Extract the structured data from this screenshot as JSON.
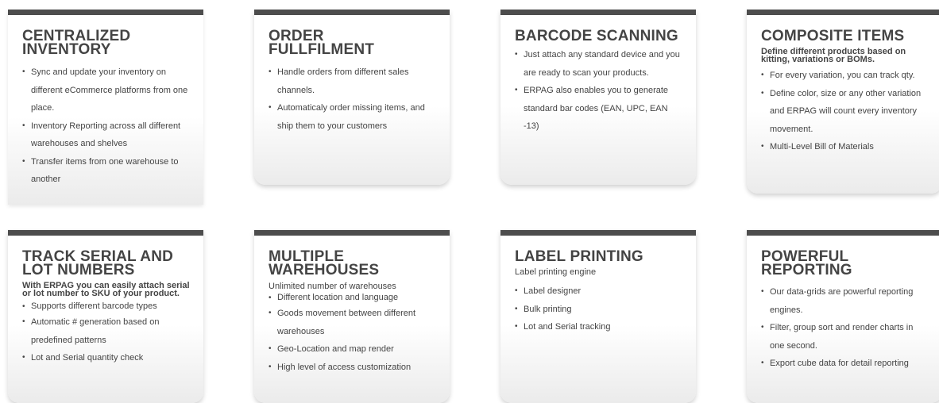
{
  "cards": [
    {
      "title": "CENTRALIZED INVENTORY",
      "subtitle": "",
      "items": [
        "Sync and update your inventory on different eCommerce platforms from one place.",
        "Inventory Reporting across all different warehouses and shelves",
        "Transfer items from one warehouse to another"
      ]
    },
    {
      "title": "ORDER FULLFILMENT",
      "subtitle": "",
      "items": [
        "Handle orders from different sales channels.",
        "Automaticaly order missing items, and ship them to your customers"
      ]
    },
    {
      "title": "BARCODE SCANNING",
      "subtitle": "",
      "items": [
        "Just attach any standard device and you are ready to scan your products.",
        "ERPAG also enables you to generate standard bar codes (EAN, UPC, EAN -13)"
      ]
    },
    {
      "title": "COMPOSITE ITEMS",
      "subtitle": "Define different products based on kitting, variations or BOMs.",
      "items": [
        "For every variation, you can track qty.",
        "Define color, size or any other variation and ERPAG will count every inventory movement.",
        "Multi-Level Bill of Materials"
      ]
    },
    {
      "title": "TRACK SERIAL AND LOT NUMBERS",
      "subtitle": "With ERPAG you can easily attach serial or lot number to SKU of your product.",
      "items": [
        "Supports different barcode types",
        "Automatic # generation based on predefined patterns",
        "Lot and Serial quantity check"
      ]
    },
    {
      "title": "MULTIPLE WAREHOUSES",
      "subtitle": "Unlimited number of warehouses",
      "items": [
        "Different location and language",
        "Goods movement between different warehouses",
        "Geo-Location and map render",
        "High level of access customization"
      ]
    },
    {
      "title": "LABEL PRINTING",
      "subtitle": "Label printing engine",
      "items": [
        "Label designer",
        "Bulk printing",
        "Lot and Serial tracking"
      ]
    },
    {
      "title": "POWERFUL REPORTING",
      "subtitle": "",
      "items": [
        "Our data-grids are powerful reporting engines.",
        "Filter, group sort and render charts in one second.",
        "Export cube data for detail reporting"
      ]
    }
  ]
}
